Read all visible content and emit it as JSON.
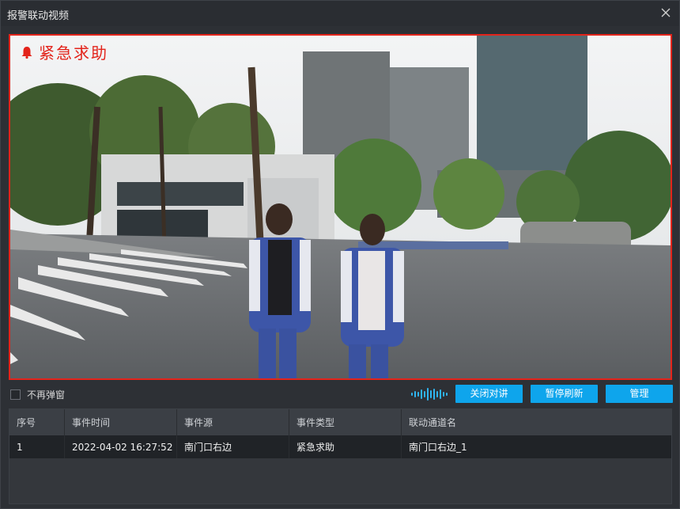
{
  "window": {
    "title": "报警联动视频"
  },
  "video": {
    "alarm_label": "紧急求助"
  },
  "controls": {
    "no_popup_label": "不再弹窗",
    "close_talk": "关闭对讲",
    "pause_refresh": "暂停刷新",
    "manage": "管理"
  },
  "table": {
    "headers": [
      "序号",
      "事件时间",
      "事件源",
      "事件类型",
      "联动通道名"
    ],
    "rows": [
      [
        "1",
        "2022-04-02 16:27:52",
        "南门口右边",
        "紧急求助",
        "南门口右边_1"
      ]
    ]
  },
  "colors": {
    "accent": "#0ea5ec",
    "alarm": "#e3241b"
  }
}
